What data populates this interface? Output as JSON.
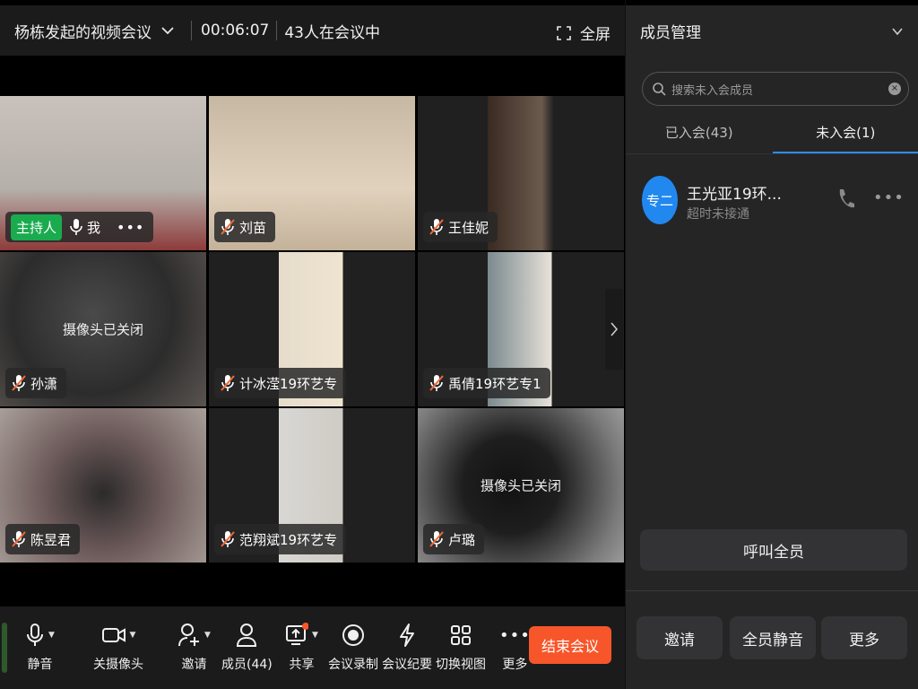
{
  "header": {
    "title": "杨栋发起的视频会议",
    "timer": "00:06:07",
    "participants_text": "43人在会议中",
    "fullscreen_label": "全屏"
  },
  "tiles": [
    {
      "name": "我",
      "host_badge": "主持人",
      "muted": false,
      "camera_off_text": ""
    },
    {
      "name": "刘苗",
      "muted": true,
      "camera_off_text": ""
    },
    {
      "name": "王佳妮",
      "muted": true,
      "camera_off_text": ""
    },
    {
      "name": "孙潇",
      "muted": true,
      "camera_off_text": "摄像头已关闭"
    },
    {
      "name": "计冰滢19环艺专",
      "muted": true,
      "camera_off_text": ""
    },
    {
      "name": "禹倩19环艺专1",
      "muted": true,
      "camera_off_text": ""
    },
    {
      "name": "陈昱君",
      "muted": true,
      "camera_off_text": ""
    },
    {
      "name": "范翔斌19环艺专",
      "muted": true,
      "camera_off_text": ""
    },
    {
      "name": "卢璐",
      "muted": true,
      "camera_off_text": "摄像头已关闭"
    }
  ],
  "toolbar": {
    "mute": "静音",
    "camera": "关摄像头",
    "invite": "邀请",
    "members": "成员(44)",
    "share": "共享",
    "record": "会议录制",
    "minutes": "会议纪要",
    "switch_view": "切换视图",
    "more": "更多",
    "end_meeting": "结束会议"
  },
  "panel": {
    "title": "成员管理",
    "search_placeholder": "搜索未入会成员",
    "tab_joined": "已入会(43)",
    "tab_not_joined": "未入会(1)",
    "member": {
      "avatar_text": "专二",
      "name": "王光亚19环...",
      "status": "超时未接通"
    },
    "call_all": "呼叫全员",
    "invite": "邀请",
    "mute_all": "全员静音",
    "more": "更多"
  },
  "colors": {
    "accent": "#2d8cf0",
    "end_button": "#f7562a",
    "host_badge": "#1aab4f",
    "muted_icon": "#f06a3a"
  }
}
